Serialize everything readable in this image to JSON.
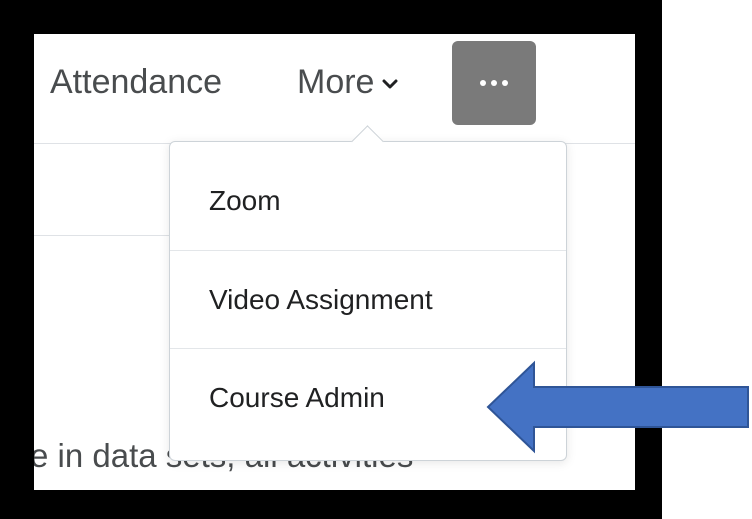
{
  "nav": {
    "attendance_label": "Attendance",
    "more_label": "More",
    "overflow_icon": "ellipsis-icon"
  },
  "dropdown": {
    "items": [
      {
        "label": "Zoom"
      },
      {
        "label": "Video Assignment"
      },
      {
        "label": "Course Admin"
      }
    ]
  },
  "page": {
    "body_snippet": "e in data sets, all activities"
  },
  "colors": {
    "frame": "#000000",
    "overflow_button": "#7a7a7a",
    "arrow_fill": "#4472c4",
    "arrow_stroke": "#2f5597"
  }
}
